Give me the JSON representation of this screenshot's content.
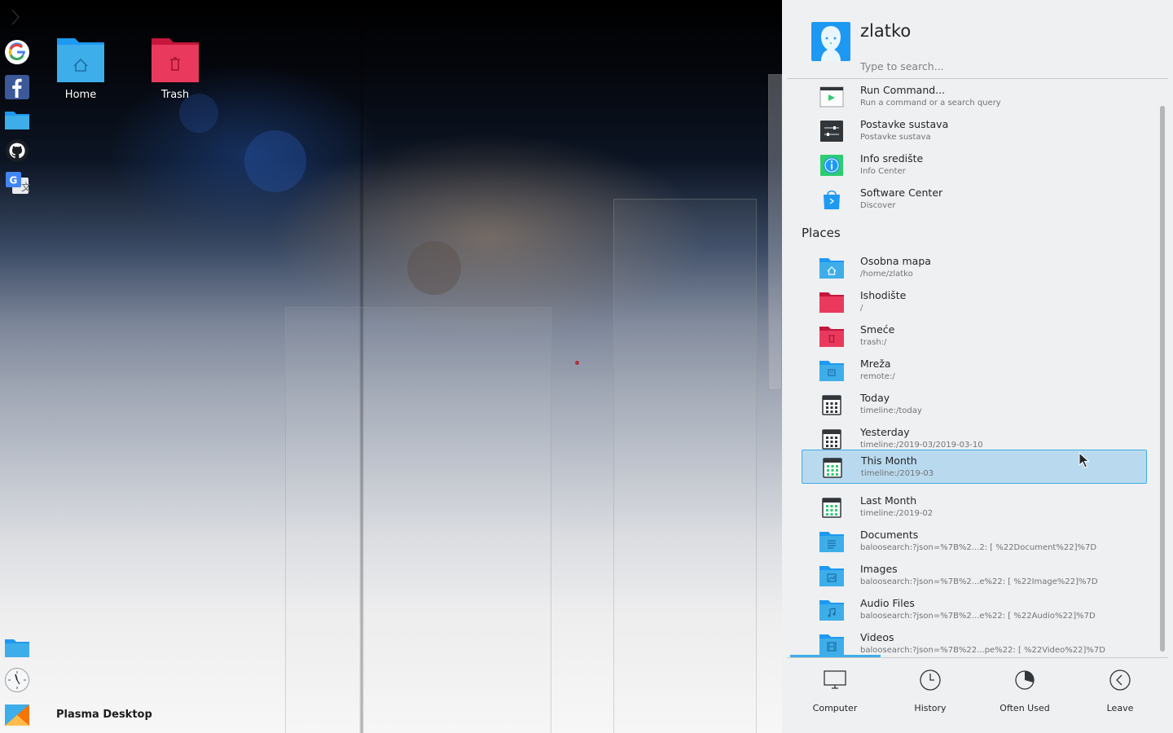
{
  "desktop": {
    "icons": [
      {
        "label": "Home",
        "icon": "folder-home-icon"
      },
      {
        "label": "Trash",
        "icon": "trash-folder-icon"
      }
    ],
    "activity_label": "Plasma Desktop"
  },
  "dock": {
    "top_apps": [
      {
        "name": "google-icon"
      },
      {
        "name": "facebook-icon"
      },
      {
        "name": "folder-icon"
      },
      {
        "name": "github-icon"
      },
      {
        "name": "google-translate-icon"
      }
    ],
    "bottom_apps": [
      {
        "name": "folder-icon"
      },
      {
        "name": "clock-icon"
      },
      {
        "name": "plasma-icon"
      }
    ]
  },
  "launcher": {
    "user": {
      "name": "zlatko"
    },
    "search": {
      "placeholder": "Type to search..."
    },
    "applications": [
      {
        "title": "Run Command...",
        "subtitle": "Run a command or a search query",
        "icon": "run-command-icon"
      },
      {
        "title": "Postavke sustava",
        "subtitle": "Postavke sustava",
        "icon": "system-settings-icon"
      },
      {
        "title": "Info središte",
        "subtitle": "Info Center",
        "icon": "info-center-icon"
      },
      {
        "title": "Software Center",
        "subtitle": "Discover",
        "icon": "software-center-icon"
      }
    ],
    "places_heading": "Places",
    "places": [
      {
        "title": "Osobna mapa",
        "subtitle": "/home/zlatko",
        "icon": "folder-home-icon"
      },
      {
        "title": "Ishodište",
        "subtitle": "/",
        "icon": "folder-red-icon"
      },
      {
        "title": "Smeće",
        "subtitle": "trash:/",
        "icon": "trash-folder-icon"
      },
      {
        "title": "Mreža",
        "subtitle": "remote:/",
        "icon": "network-folder-icon"
      },
      {
        "title": "Today",
        "subtitle": "timeline:/today",
        "icon": "calendar-icon"
      },
      {
        "title": "Yesterday",
        "subtitle": "timeline:/2019-03/2019-03-10",
        "icon": "calendar-icon"
      },
      {
        "title": "This Month",
        "subtitle": "timeline:/2019-03",
        "icon": "calendar-month-icon",
        "selected": true
      },
      {
        "title": "Last Month",
        "subtitle": "timeline:/2019-02",
        "icon": "calendar-month-icon"
      },
      {
        "title": "Documents",
        "subtitle": "baloosearch:?json=%7B%2...2: [ %22Document%22]%7D",
        "icon": "folder-documents-icon"
      },
      {
        "title": "Images",
        "subtitle": "baloosearch:?json=%7B%2...e%22: [ %22Image%22]%7D",
        "icon": "folder-images-icon"
      },
      {
        "title": "Audio Files",
        "subtitle": "baloosearch:?json=%7B%2...e%22: [ %22Audio%22]%7D",
        "icon": "folder-music-icon"
      },
      {
        "title": "Videos",
        "subtitle": "baloosearch:?json=%7B%22...pe%22: [ %22Video%22]%7D",
        "icon": "folder-videos-icon"
      }
    ],
    "tabs": [
      {
        "label": "Computer",
        "icon": "monitor-icon",
        "active": true
      },
      {
        "label": "History",
        "icon": "clock-icon"
      },
      {
        "label": "Often Used",
        "icon": "pie-chart-icon"
      },
      {
        "label": "Leave",
        "icon": "leave-arrow-icon"
      }
    ],
    "colors": {
      "accent": "#3daee9",
      "selection": "#b9d9ee",
      "folder_blue": "#3daee9",
      "folder_red": "#e93a5d"
    }
  }
}
